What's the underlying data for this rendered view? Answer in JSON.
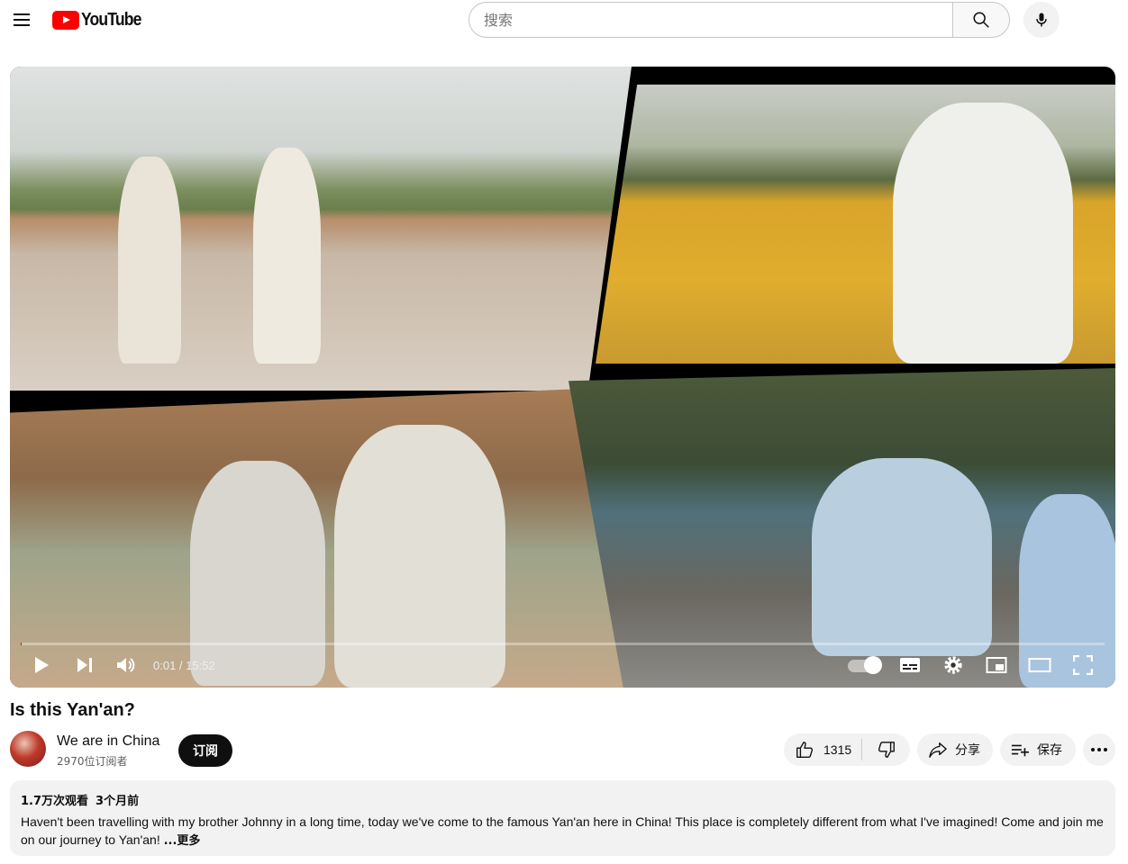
{
  "header": {
    "logo_text": "YouTube",
    "search_placeholder": "搜索",
    "search_value": "",
    "icons": [
      "menu-icon",
      "search-icon",
      "mic-icon"
    ]
  },
  "player": {
    "time_display": "0:01 / 15:52",
    "progress": 0.001,
    "icons": [
      "play-icon",
      "next-icon",
      "volume-icon",
      "autoplay-toggle",
      "subtitles-icon",
      "settings-icon",
      "miniplayer-icon",
      "theater-icon",
      "fullscreen-icon"
    ]
  },
  "video": {
    "title": "Is this Yan'an?"
  },
  "channel": {
    "name": "We are in China",
    "subscribers": "2970位订阅者",
    "subscribe_label": "订阅"
  },
  "actions": {
    "like_count": "1315",
    "share_label": "分享",
    "save_label": "保存"
  },
  "description": {
    "views": "1.7万次观看",
    "date": "3个月前",
    "text": "Haven't been travelling with my brother Johnny in a long time, today we've come to the famous Yan'an here in China! This place is completely different from what I've imagined! Come and join me on our journey to Yan'an!",
    "more_label": "...更多"
  },
  "colors": {
    "brand_red": "#ff0000",
    "text_primary": "#0f0f0f",
    "text_secondary": "#606060",
    "pill_bg": "#f2f2f2"
  }
}
